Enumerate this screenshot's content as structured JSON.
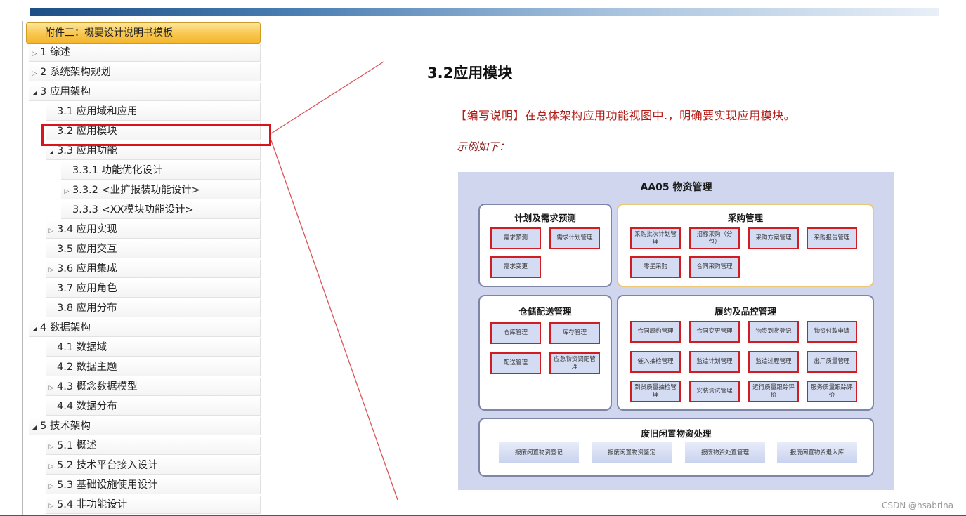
{
  "tree": {
    "header": "附件三：概要设计说明书模板",
    "items": [
      {
        "label": "1 综述",
        "arrow": "collapsed",
        "level": 0
      },
      {
        "label": "2 系统架构规划",
        "arrow": "collapsed",
        "level": 0
      },
      {
        "label": "3 应用架构",
        "arrow": "expanded",
        "level": 0
      },
      {
        "label": "3.1 应用域和应用",
        "arrow": "none",
        "level": 1
      },
      {
        "label": "3.2 应用模块",
        "arrow": "none",
        "level": 1,
        "selected": true
      },
      {
        "label": "3.3 应用功能",
        "arrow": "expanded",
        "level": 1
      },
      {
        "label": "3.3.1 功能优化设计",
        "arrow": "none",
        "level": 2
      },
      {
        "label": "3.3.2 <业扩报装功能设计>",
        "arrow": "collapsed",
        "level": 2
      },
      {
        "label": "3.3.3 <XX模块功能设计>",
        "arrow": "none",
        "level": 2
      },
      {
        "label": "3.4 应用实现",
        "arrow": "collapsed",
        "level": 1
      },
      {
        "label": "3.5 应用交互",
        "arrow": "none",
        "level": 1
      },
      {
        "label": "3.6 应用集成",
        "arrow": "collapsed",
        "level": 1
      },
      {
        "label": "3.7 应用角色",
        "arrow": "none",
        "level": 1
      },
      {
        "label": "3.8 应用分布",
        "arrow": "none",
        "level": 1
      },
      {
        "label": "4 数据架构",
        "arrow": "expanded",
        "level": 0
      },
      {
        "label": "4.1 数据域",
        "arrow": "none",
        "level": 1
      },
      {
        "label": "4.2 数据主题",
        "arrow": "none",
        "level": 1
      },
      {
        "label": "4.3 概念数据模型",
        "arrow": "collapsed",
        "level": 1
      },
      {
        "label": "4.4 数据分布",
        "arrow": "none",
        "level": 1
      },
      {
        "label": "5 技术架构",
        "arrow": "expanded",
        "level": 0
      },
      {
        "label": "5.1 概述",
        "arrow": "collapsed",
        "level": 1
      },
      {
        "label": "5.2 技术平台接入设计",
        "arrow": "collapsed",
        "level": 1
      },
      {
        "label": "5.3 基础设施使用设计",
        "arrow": "collapsed",
        "level": 1
      },
      {
        "label": "5.4 非功能设计",
        "arrow": "collapsed",
        "level": 1
      }
    ]
  },
  "doc": {
    "title": "3.2应用模块",
    "instruction": "【编写说明】在总体架构应用功能视图中.，明确要实现应用模块。",
    "example": "示例如下："
  },
  "diagram": {
    "title": "AA05 物资管理",
    "panels": {
      "plan": {
        "title": "计划及需求预测",
        "modules": [
          "需求预测",
          "需求计划管理",
          "需求变更"
        ]
      },
      "purchase": {
        "title": "采购管理",
        "modules": [
          "采购批次计划管理",
          "招标采购（分包）",
          "采购方案管理",
          "采购报告管理",
          "零星采购",
          "合同采购管理"
        ]
      },
      "storage": {
        "title": "仓储配送管理",
        "modules": [
          "仓库管理",
          "库存管理",
          "配送管理",
          "应急物资调配管理"
        ]
      },
      "contract": {
        "title": "履约及品控管理",
        "modules": [
          "合同履约管理",
          "合同变更管理",
          "物资到货登记",
          "物资付款申请",
          "催入抽检管理",
          "监造计划管理",
          "监造过程管理",
          "出厂质量管理",
          "到货质量抽检管理",
          "安装调试管理",
          "运行质量跟踪评价",
          "服务质量跟踪评价"
        ]
      },
      "waste": {
        "title": "废旧闲置物资处理",
        "modules": [
          "报废闲置物资登记",
          "报废闲置物资鉴定",
          "报废物资处置管理",
          "报废闲置物资退入库"
        ]
      }
    }
  },
  "watermark": "CSDN @hsabrina",
  "colors": {
    "highlight_red": "#d9141b",
    "tree_header": "#f8c64d",
    "diagram_bg": "#cfd6ee",
    "instruction_text": "#b31c17"
  }
}
